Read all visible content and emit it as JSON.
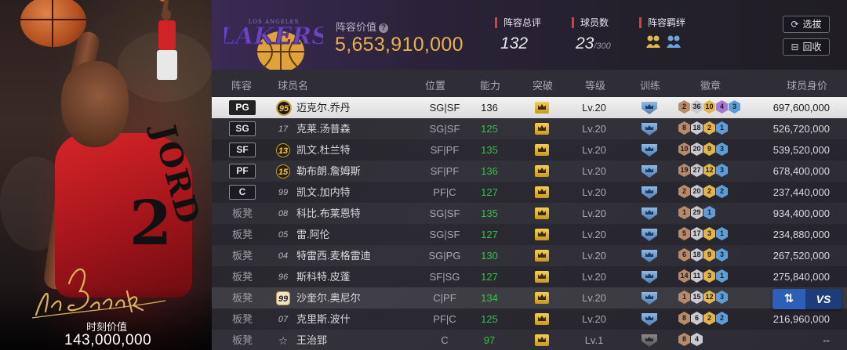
{
  "hero": {
    "signature": "I'm Back",
    "value_label": "时刻价值",
    "value": "143,000,000"
  },
  "header": {
    "team_logo_text": "LAKERS",
    "team_logo_city": "LOS ANGELES",
    "lineup_value_label": "阵容价值",
    "lineup_value": "5,653,910,000",
    "total_rating_label": "阵容总评",
    "total_rating": "132",
    "player_count_label": "球员数",
    "player_count": "23",
    "player_count_max": "/300",
    "synergy_label": "阵容羁绊",
    "select_button": "选拔",
    "recycle_button": "回收"
  },
  "columns": [
    "阵容",
    "球员名",
    "位置",
    "能力",
    "突破",
    "等级",
    "训练",
    "徽章",
    "球员身价"
  ],
  "rows": [
    {
      "slot": "PG",
      "slot_style": "box",
      "jersey": "95",
      "jersey_style": "gold-big",
      "name": "迈克尔.乔丹",
      "position": "SG|SF",
      "ability": "136",
      "level": "Lv.20",
      "train": "blue",
      "badges": [
        [
          "2",
          "bronze"
        ],
        [
          "36",
          "silver"
        ],
        [
          "10",
          "gold"
        ],
        [
          "4",
          "purple"
        ],
        [
          "3",
          "blue"
        ]
      ],
      "value": "697,600,000",
      "state": "selected"
    },
    {
      "slot": "SG",
      "slot_style": "box",
      "jersey": "17",
      "jersey_style": "plain",
      "name": "克莱.汤普森",
      "position": "SG|SF",
      "ability": "125",
      "level": "Lv.20",
      "train": "blue",
      "badges": [
        [
          "8",
          "bronze"
        ],
        [
          "18",
          "silver"
        ],
        [
          "2",
          "gold"
        ],
        [
          "1",
          "blue"
        ]
      ],
      "value": "526,720,000",
      "state": "alt"
    },
    {
      "slot": "SF",
      "slot_style": "box",
      "jersey": "13",
      "jersey_style": "gold",
      "name": "凯文.杜兰特",
      "position": "SF|PF",
      "ability": "135",
      "level": "Lv.20",
      "train": "blue",
      "badges": [
        [
          "10",
          "bronze"
        ],
        [
          "20",
          "silver"
        ],
        [
          "9",
          "gold"
        ],
        [
          "3",
          "blue"
        ]
      ],
      "value": "539,520,000",
      "state": ""
    },
    {
      "slot": "PF",
      "slot_style": "box",
      "jersey": "15",
      "jersey_style": "gold",
      "name": "勒布朗.詹姆斯",
      "position": "SF|PF",
      "ability": "136",
      "level": "Lv.20",
      "train": "blue",
      "badges": [
        [
          "19",
          "bronze"
        ],
        [
          "27",
          "silver"
        ],
        [
          "12",
          "gold"
        ],
        [
          "3",
          "blue"
        ]
      ],
      "value": "678,400,000",
      "state": "alt"
    },
    {
      "slot": "C",
      "slot_style": "box",
      "jersey": "99",
      "jersey_style": "plain",
      "name": "凯文.加内特",
      "position": "PF|C",
      "ability": "127",
      "level": "Lv.20",
      "train": "blue",
      "badges": [
        [
          "2",
          "bronze"
        ],
        [
          "20",
          "silver"
        ],
        [
          "2",
          "gold"
        ],
        [
          "2",
          "blue"
        ]
      ],
      "value": "237,440,000",
      "state": ""
    },
    {
      "slot": "板凳",
      "slot_style": "text",
      "jersey": "08",
      "jersey_style": "plain",
      "name": "科比.布莱恩特",
      "position": "SG|SF",
      "ability": "135",
      "level": "Lv.20",
      "train": "blue",
      "badges": [
        [
          "1",
          "bronze"
        ],
        [
          "29",
          "silver"
        ],
        [
          "1",
          "blue"
        ]
      ],
      "value": "934,400,000",
      "state": "alt"
    },
    {
      "slot": "板凳",
      "slot_style": "text",
      "jersey": "05",
      "jersey_style": "plain",
      "name": "雷.阿伦",
      "position": "SG|SF",
      "ability": "127",
      "level": "Lv.20",
      "train": "blue",
      "badges": [
        [
          "5",
          "bronze"
        ],
        [
          "17",
          "silver"
        ],
        [
          "3",
          "gold"
        ],
        [
          "1",
          "blue"
        ]
      ],
      "value": "234,880,000",
      "state": ""
    },
    {
      "slot": "板凳",
      "slot_style": "text",
      "jersey": "04",
      "jersey_style": "plain",
      "name": "特雷西.麦格雷迪",
      "position": "SG|PG",
      "ability": "130",
      "level": "Lv.20",
      "train": "blue",
      "badges": [
        [
          "6",
          "bronze"
        ],
        [
          "18",
          "silver"
        ],
        [
          "9",
          "gold"
        ],
        [
          "3",
          "blue"
        ]
      ],
      "value": "267,520,000",
      "state": "alt"
    },
    {
      "slot": "板凳",
      "slot_style": "text",
      "jersey": "96",
      "jersey_style": "plain",
      "name": "斯科特.皮蓬",
      "position": "SF|SG",
      "ability": "127",
      "level": "Lv.20",
      "train": "blue",
      "badges": [
        [
          "14",
          "bronze"
        ],
        [
          "11",
          "silver"
        ],
        [
          "3",
          "gold"
        ],
        [
          "1",
          "blue"
        ]
      ],
      "value": "275,840,000",
      "state": ""
    },
    {
      "slot": "板凳",
      "slot_style": "text",
      "jersey": "99",
      "jersey_style": "gold-sq",
      "name": "沙奎尔.奥尼尔",
      "position": "C|PF",
      "ability": "134",
      "level": "Lv.20",
      "train": "blue",
      "badges": [
        [
          "1",
          "bronze"
        ],
        [
          "15",
          "silver"
        ],
        [
          "12",
          "gold"
        ],
        [
          "3",
          "blue"
        ]
      ],
      "value": "",
      "state": "highlight"
    },
    {
      "slot": "板凳",
      "slot_style": "text",
      "jersey": "07",
      "jersey_style": "plain",
      "name": "克里斯.波什",
      "position": "PF|C",
      "ability": "125",
      "level": "Lv.20",
      "train": "blue",
      "badges": [
        [
          "8",
          "bronze"
        ],
        [
          "6",
          "silver"
        ],
        [
          "2",
          "gold"
        ],
        [
          "2",
          "blue"
        ]
      ],
      "value": "216,960,000",
      "state": ""
    },
    {
      "slot": "板凳",
      "slot_style": "text",
      "jersey": "☆",
      "jersey_style": "star",
      "name": "王治郅",
      "position": "C",
      "ability": "97",
      "level": "Lv.1",
      "train": "gray",
      "badges": [
        [
          "8",
          "bronze"
        ],
        [
          "4",
          "silver"
        ]
      ],
      "value": "--",
      "state": "alt"
    }
  ],
  "vs_button": {
    "swap_icon": "⇅",
    "label": "VS"
  }
}
